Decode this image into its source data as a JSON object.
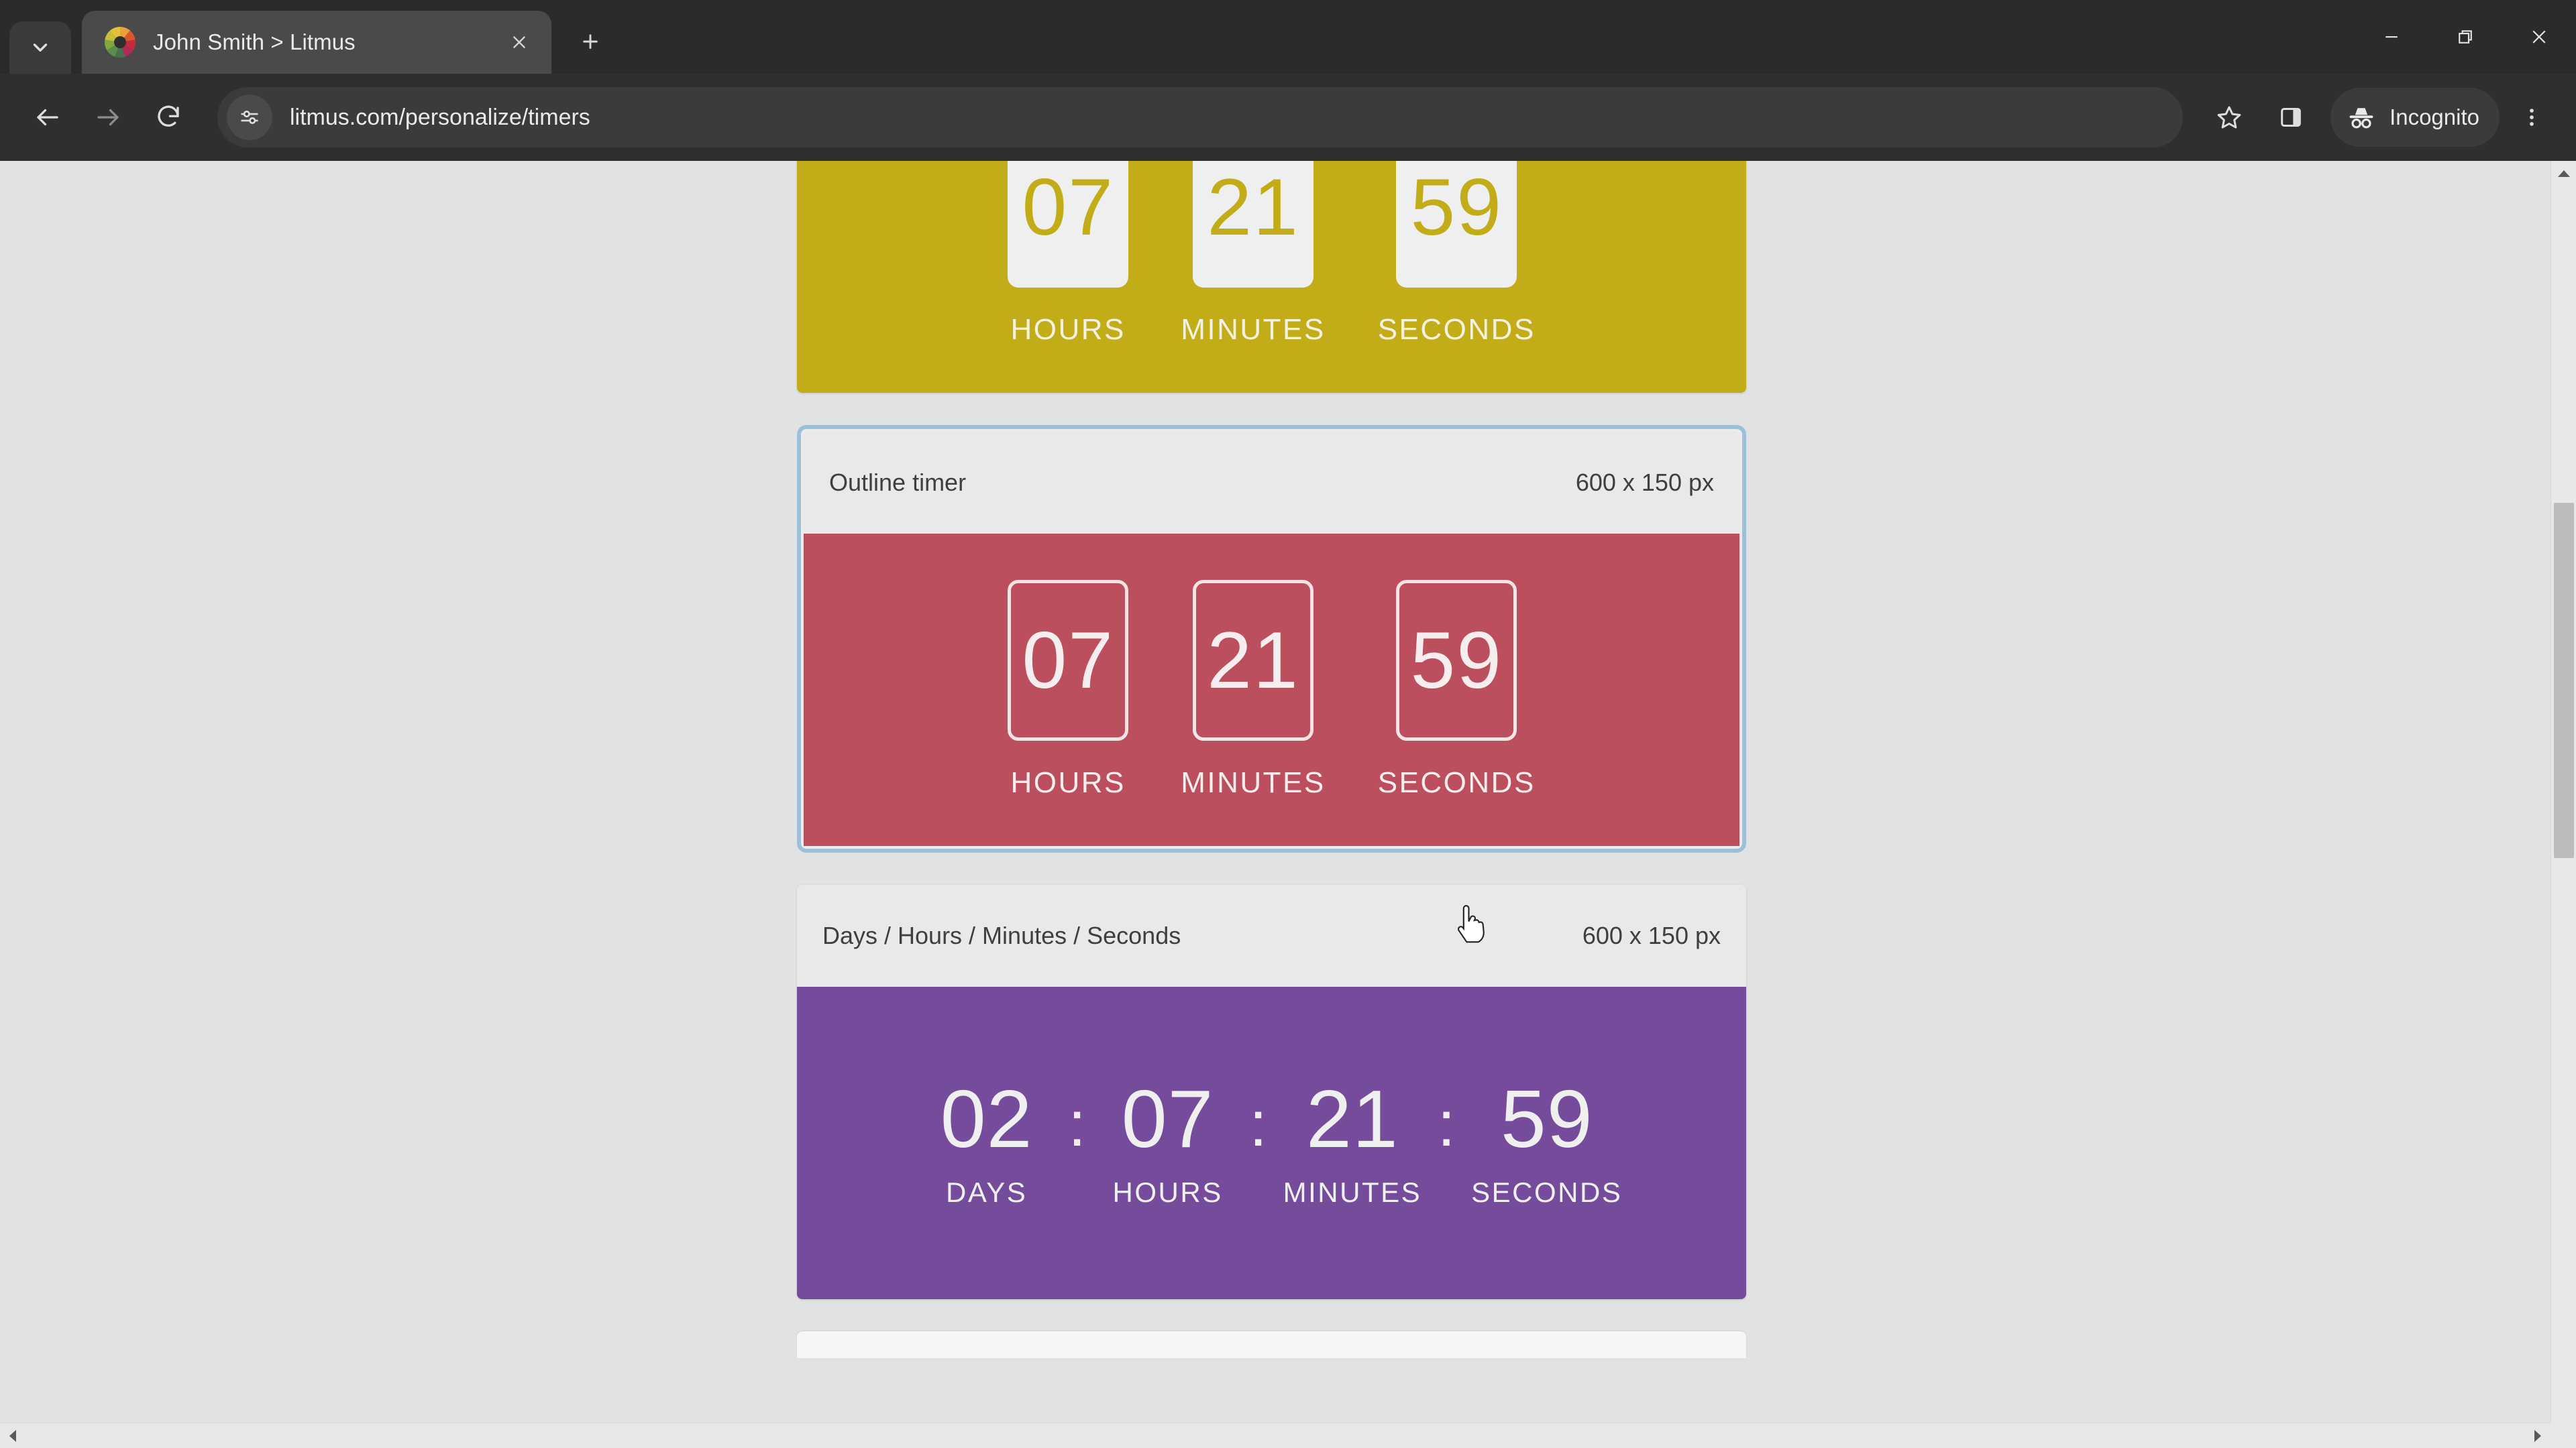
{
  "browser": {
    "tab_search_icon": "chevron-down-icon",
    "tab": {
      "title": "John Smith > Litmus",
      "favicon": "litmus-logo-icon",
      "close_icon": "close-icon"
    },
    "new_tab_label": "+",
    "window_controls": {
      "minimize": "minimize-icon",
      "maximize": "restore-icon",
      "close": "close-icon"
    },
    "toolbar": {
      "back_icon": "arrow-left-icon",
      "forward_icon": "arrow-right-icon",
      "reload_icon": "reload-icon",
      "site_info_icon": "tune-icon",
      "url": "litmus.com/personalize/timers",
      "bookmark_icon": "star-icon",
      "side_panel_icon": "side-panel-icon",
      "incognito_icon": "incognito-icon",
      "incognito_label": "Incognito",
      "menu_icon": "three-dots-vertical-icon"
    }
  },
  "colors": {
    "page_background": "#E1E2E4",
    "card_header_background": "#E9E9E9",
    "selected_border": "#9CC0D8",
    "gold": "#C2AD19",
    "red": "#BC4F5E",
    "purple": "#744C9B",
    "digit_light": "#EFEFEF"
  },
  "page": {
    "timers": [
      {
        "id": "gold-timer",
        "title": "",
        "dimensions": "",
        "style": "gold",
        "selected": false,
        "show_header": false,
        "layout": "boxed",
        "units": [
          {
            "value": "07",
            "label": "HOURS"
          },
          {
            "value": "21",
            "label": "MINUTES"
          },
          {
            "value": "59",
            "label": "SECONDS"
          }
        ]
      },
      {
        "id": "outline-timer",
        "title": "Outline timer",
        "dimensions": "600 x 150 px",
        "style": "red",
        "selected": true,
        "show_header": true,
        "layout": "boxed",
        "units": [
          {
            "value": "07",
            "label": "HOURS"
          },
          {
            "value": "21",
            "label": "MINUTES"
          },
          {
            "value": "59",
            "label": "SECONDS"
          }
        ]
      },
      {
        "id": "dhms-timer",
        "title": "Days / Hours / Minutes / Seconds",
        "dimensions": "600 x 150 px",
        "style": "purple",
        "selected": false,
        "show_header": true,
        "layout": "inline",
        "separator": ":",
        "units": [
          {
            "value": "02",
            "label": "DAYS"
          },
          {
            "value": "07",
            "label": "HOURS"
          },
          {
            "value": "21",
            "label": "MINUTES"
          },
          {
            "value": "59",
            "label": "SECONDS"
          }
        ]
      }
    ]
  },
  "scrollbars": {
    "vertical": {
      "up_arrow": "scroll-up-arrow",
      "down_arrow": "scroll-down-arrow"
    },
    "horizontal": {
      "left_arrow": "scroll-left-arrow",
      "right_arrow": "scroll-right-arrow"
    }
  },
  "cursor": {
    "type": "pointer-hand"
  }
}
